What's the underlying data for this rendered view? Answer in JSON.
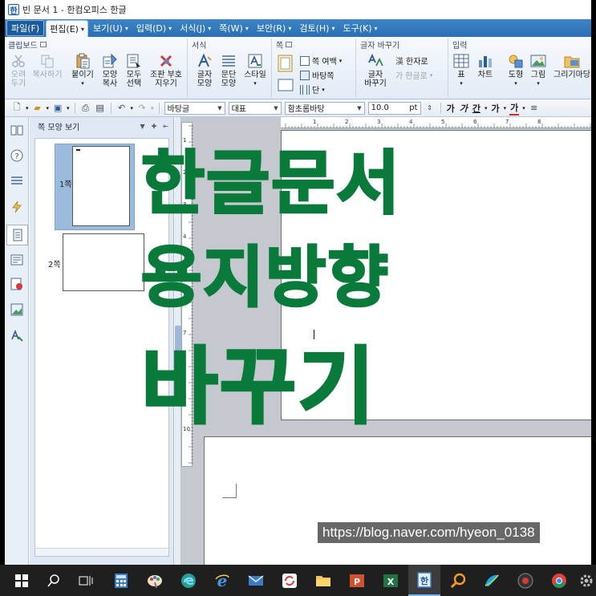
{
  "window": {
    "title": "빈 문서 1 - 한컴오피스 한글"
  },
  "menubar": {
    "items": [
      {
        "label": "파일(F)"
      },
      {
        "label": "편집(E)"
      },
      {
        "label": "보기(U)"
      },
      {
        "label": "입력(D)"
      },
      {
        "label": "서식(J)"
      },
      {
        "label": "쪽(W)"
      },
      {
        "label": "보안(R)"
      },
      {
        "label": "검토(H)"
      },
      {
        "label": "도구(K)"
      }
    ]
  },
  "ribbon": {
    "groups": {
      "clipboard": "클립보드",
      "format": "서식",
      "page": "쪽",
      "char_convert": "글자 바꾸기",
      "input": "입력"
    },
    "buttons": {
      "cut": [
        "오려",
        "두기"
      ],
      "copy": [
        "복사하기"
      ],
      "paste": [
        "붙이기"
      ],
      "format_copy": [
        "모양",
        "복사"
      ],
      "select_all": [
        "모두",
        "선택"
      ],
      "erase_marks": [
        "조판 부호",
        "지우기"
      ],
      "char_shape": [
        "글자",
        "모양"
      ],
      "para_shape": [
        "문단",
        "모양"
      ],
      "style": [
        "스타일"
      ],
      "page_margin": "쪽 여백",
      "page_bg": "바탕쪽",
      "column": "단",
      "char_change": [
        "글자",
        "바꾸기"
      ],
      "hanja": "한자로",
      "hangul": "한글로",
      "table": "표",
      "chart": "차트",
      "shape": "도형",
      "picture": "그림",
      "drawing": "그리기마당"
    }
  },
  "fmtbar": {
    "style": "바탕글",
    "lang": "대표",
    "font": "함초롬바탕",
    "size": "10.0",
    "unit": "pt",
    "bold": "가",
    "italic": "가",
    "underline": "간",
    "strike": "가",
    "color": "가"
  },
  "pane": {
    "title": "쪽 모양 보기",
    "pages": [
      {
        "label": "1쪽"
      },
      {
        "label": "2쪽"
      }
    ]
  },
  "ruler": {
    "h_ticks": [
      "1",
      "2",
      "3",
      "4",
      "5",
      "6",
      "7",
      "8"
    ],
    "v_ticks": [
      "1",
      "2",
      "3",
      "4",
      "5",
      "6",
      "7",
      "8",
      "9",
      "10"
    ]
  },
  "overlay": {
    "line1": "한글문서",
    "line2": "용지방향",
    "line3": "바꾸기",
    "color": "#0a7a3a"
  },
  "watermark": "https://blog.naver.com/hyeon_0138",
  "taskbar": {
    "items": [
      "start-icon",
      "search-icon",
      "task-view-icon",
      "calculator-icon",
      "paint-icon",
      "edge-icon",
      "ie-icon",
      "mail-icon",
      "sync-icon",
      "folder-icon",
      "powerpoint-icon",
      "excel-icon",
      "hwp-icon",
      "magnifier-icon",
      "app-icon",
      "recorder-icon",
      "chrome-icon",
      "settings-icon"
    ]
  }
}
